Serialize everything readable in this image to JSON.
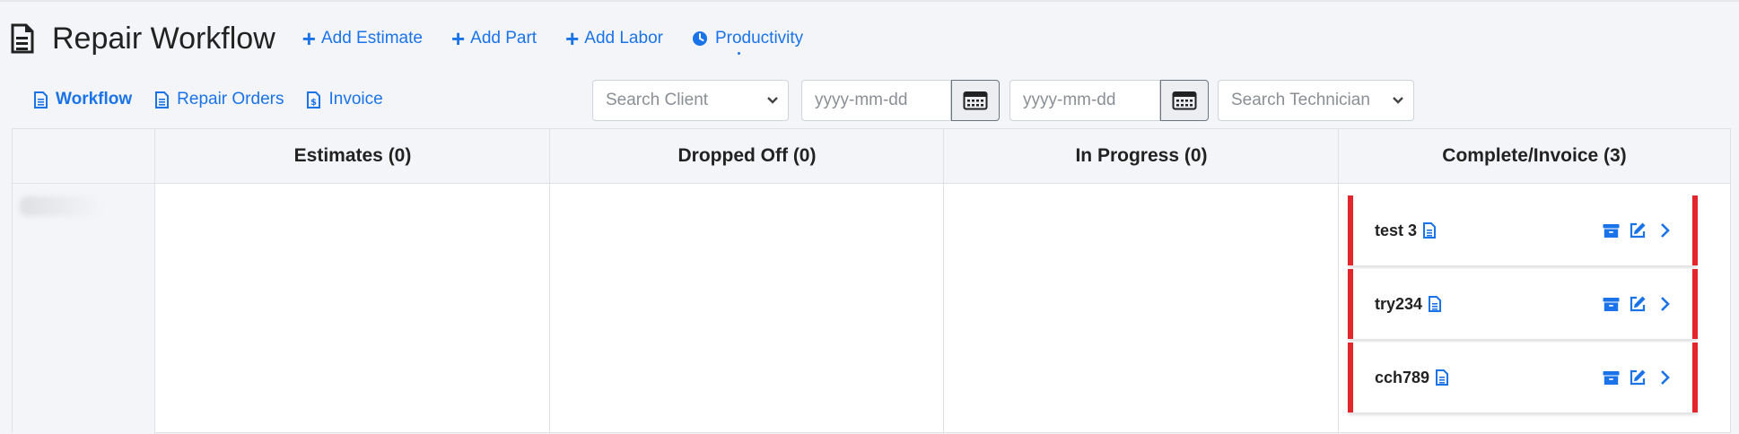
{
  "header": {
    "title": "Repair Workflow",
    "links": [
      {
        "label": "Add Estimate"
      },
      {
        "label": "Add Part"
      },
      {
        "label": "Add Labor"
      },
      {
        "label": "Productivity"
      }
    ]
  },
  "subnav": {
    "items": [
      {
        "label": "Workflow",
        "active": true
      },
      {
        "label": "Repair Orders"
      },
      {
        "label": "Invoice"
      }
    ]
  },
  "filters": {
    "client_placeholder": "Search Client",
    "date_from_placeholder": "yyyy-mm-dd",
    "date_to_placeholder": "yyyy-mm-dd",
    "technician_placeholder": "Search Technician"
  },
  "board": {
    "columns": [
      {
        "label": "Estimates (0)"
      },
      {
        "label": "Dropped Off (0)"
      },
      {
        "label": "In Progress (0)"
      },
      {
        "label": "Complete/Invoice (3)"
      }
    ],
    "cards": [
      {
        "name": "test 3"
      },
      {
        "name": "try234"
      },
      {
        "name": "cch789"
      }
    ]
  },
  "colors": {
    "accent": "#1a73e8",
    "card_border": "#e3262c"
  }
}
